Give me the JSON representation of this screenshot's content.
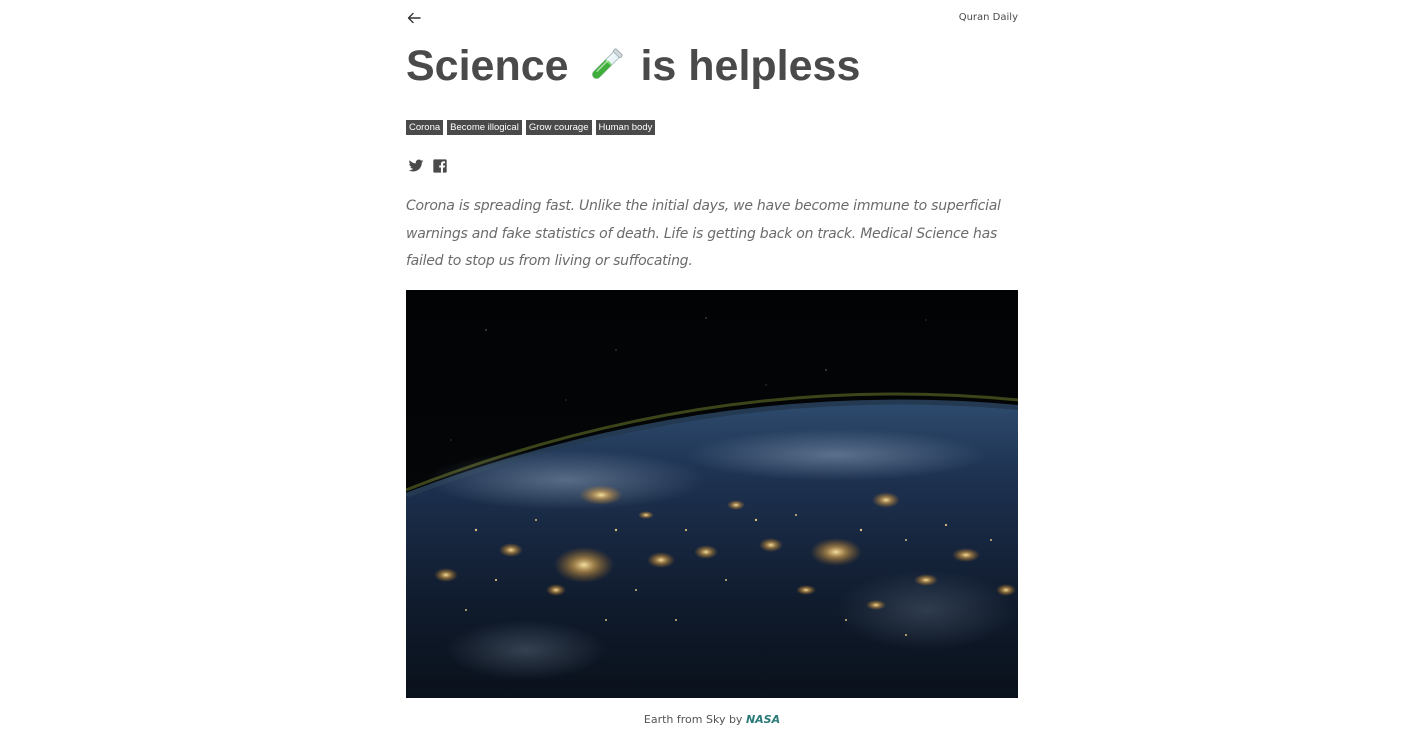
{
  "header": {
    "back_icon": "arrow-left-icon",
    "site_name": "Quran Daily"
  },
  "article": {
    "title_before": "Science",
    "title_emoji": "test-tube-icon",
    "title_after": "is helpless",
    "tags": [
      "Corona",
      "Become illogical",
      "Grow courage",
      "Human body"
    ],
    "share": {
      "twitter_icon": "twitter-icon",
      "facebook_icon": "facebook-icon"
    },
    "intro": "Corona is spreading fast. Unlike the initial days, we have become immune to superficial warnings and fake statistics of death. Life is getting back on track. Medical Science has failed to stop us from living or suffocating.",
    "image": {
      "description_icon": "earth-at-night-photo"
    },
    "caption": {
      "text": "Earth from Sky by",
      "credit": "NASA"
    }
  },
  "colors": {
    "text": "#4a4a4a",
    "tag_bg": "#4a4a4a",
    "tag_text": "#ffffff",
    "intro_text": "#6b6b6b",
    "link": "#2a7a7a"
  }
}
